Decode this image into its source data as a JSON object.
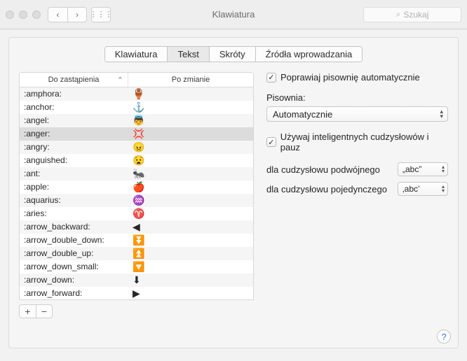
{
  "window": {
    "title": "Klawiatura",
    "search_placeholder": "Szukaj"
  },
  "tabs": {
    "t0": "Klawiatura",
    "t1": "Tekst",
    "t2": "Skróty",
    "t3": "Źródła wprowadzania",
    "active": 1
  },
  "table": {
    "col_replace": "Do zastąpienia",
    "col_with": "Po zmianie",
    "rows": [
      {
        "k": ":amphora:",
        "v": "🏺"
      },
      {
        "k": ":anchor:",
        "v": "⚓"
      },
      {
        "k": ":angel:",
        "v": "👼"
      },
      {
        "k": ":anger:",
        "v": "💢",
        "selected": true
      },
      {
        "k": ":angry:",
        "v": "😠"
      },
      {
        "k": ":anguished:",
        "v": "😧"
      },
      {
        "k": ":ant:",
        "v": "🐜"
      },
      {
        "k": ":apple:",
        "v": "🍎"
      },
      {
        "k": ":aquarius:",
        "v": "♒"
      },
      {
        "k": ":aries:",
        "v": "♈"
      },
      {
        "k": ":arrow_backward:",
        "v": "◀"
      },
      {
        "k": ":arrow_double_down:",
        "v": "⏬"
      },
      {
        "k": ":arrow_double_up:",
        "v": "⏫"
      },
      {
        "k": ":arrow_down_small:",
        "v": "🔽"
      },
      {
        "k": ":arrow_down:",
        "v": "⬇"
      },
      {
        "k": ":arrow_forward:",
        "v": "▶"
      }
    ],
    "add": "+",
    "remove": "−"
  },
  "right": {
    "auto_correct": "Poprawiaj pisownię automatycznie",
    "spelling_label": "Pisownia:",
    "spelling_value": "Automatycznie",
    "smart_quotes": "Używaj inteligentnych cudzysłowów i pauz",
    "double_label": "dla cudzysłowu podwójnego",
    "double_value": "„abc”",
    "single_label": "dla cudzysłowu pojedynczego",
    "single_value": "‚abc’"
  },
  "icons": {
    "check": "✓",
    "chev_l": "‹",
    "chev_r": "›",
    "grid": "⋮⋮⋮",
    "search": "🔍",
    "help": "?",
    "sort": "⌃",
    "updown": "▴\n▾"
  }
}
